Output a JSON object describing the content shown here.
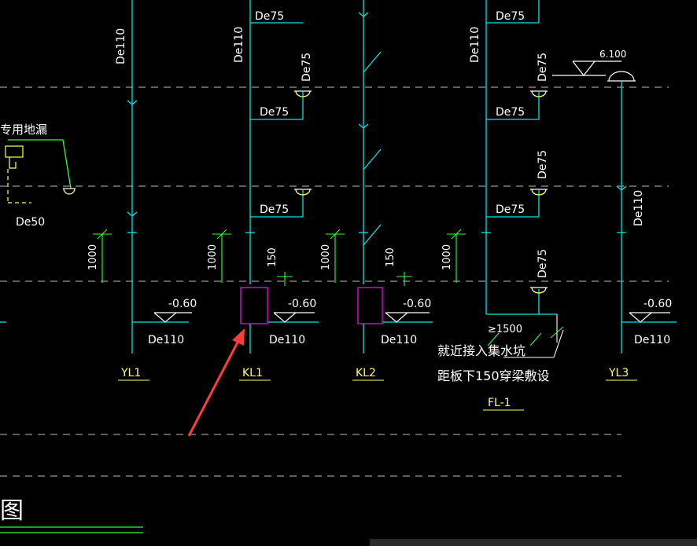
{
  "colors": {
    "background": "#000000",
    "pipe": "#00e6e6",
    "text": "#ffffff",
    "dim": "#33ff33",
    "label": "#ffff66",
    "magenta": "#e600e6",
    "arrow": "#ff3b3b",
    "dash": "#bfbfbf"
  },
  "pipe_size_labels": [
    "De110",
    "De110",
    "De75",
    "De75",
    "De75",
    "De75",
    "De75",
    "De75",
    "De75",
    "De75",
    "De75",
    "De75",
    "De110",
    "De50",
    "De110",
    "De110",
    "De110",
    "De110",
    "De110"
  ],
  "dimension_labels": [
    "1000",
    "1000",
    "1000",
    "1000",
    "150",
    "150",
    "≥1500"
  ],
  "elevation_labels": [
    "-0.60",
    "-0.60",
    "-0.60",
    "-0.60",
    "6.100"
  ],
  "pipe_tags": [
    "YL1",
    "KL1",
    "KL2",
    "FL-1",
    "YL3"
  ],
  "notes": {
    "floor_drain": "专用地漏",
    "note_line1": "就近接入集水坑",
    "note_line2": "距板下150穿梁敷设",
    "drawing_title": "图"
  }
}
